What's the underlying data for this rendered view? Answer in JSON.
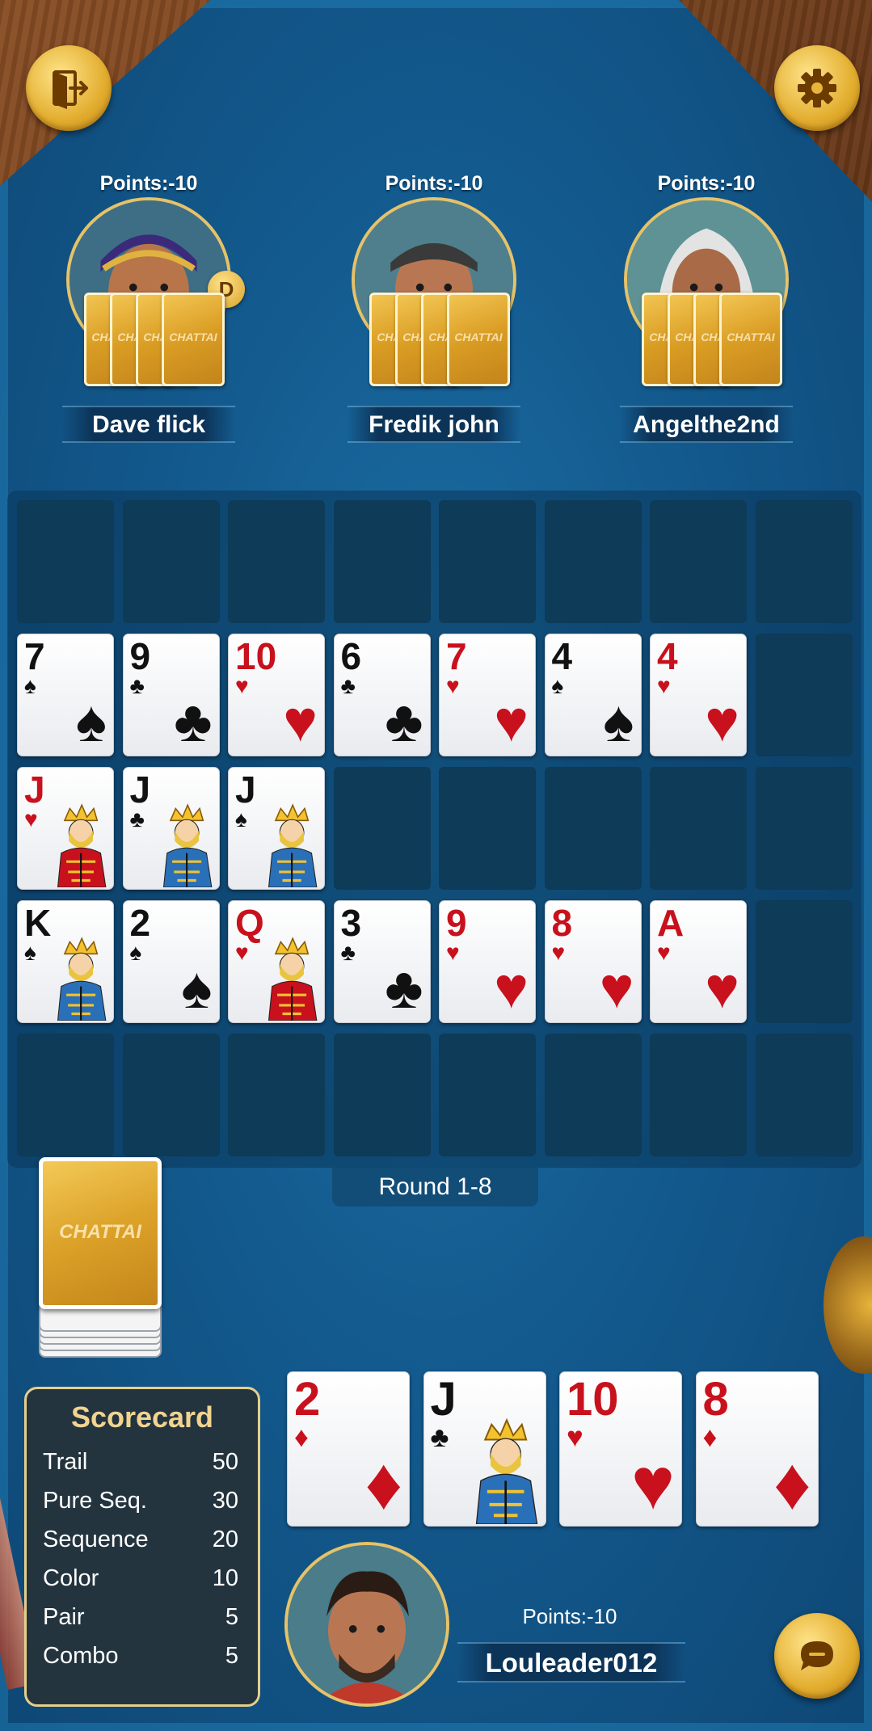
{
  "opponents": [
    {
      "name": "Dave flick",
      "points": "Points:-10",
      "dealer": "D",
      "back_label": "CHATTAI"
    },
    {
      "name": "Fredik john",
      "points": "Points:-10",
      "back_label": "CHATTAI"
    },
    {
      "name": "Angelthe2nd",
      "points": "Points:-10",
      "back_label": "CHATTAI"
    }
  ],
  "buttons": {
    "exit_icon": "exit-door-icon",
    "settings_icon": "gear-icon",
    "chat_icon": "chat-bubble-icon"
  },
  "board": {
    "rows": [
      [],
      [
        {
          "rank": "7",
          "suit": "♠",
          "color": "black"
        },
        {
          "rank": "9",
          "suit": "♣",
          "color": "black"
        },
        {
          "rank": "10",
          "suit": "♥",
          "color": "red"
        },
        {
          "rank": "6",
          "suit": "♣",
          "color": "black"
        },
        {
          "rank": "7",
          "suit": "♥",
          "color": "red"
        },
        {
          "rank": "4",
          "suit": "♠",
          "color": "black"
        },
        {
          "rank": "4",
          "suit": "♥",
          "color": "red"
        }
      ],
      [
        {
          "rank": "J",
          "suit": "♥",
          "color": "red",
          "face": true
        },
        {
          "rank": "J",
          "suit": "♣",
          "color": "black",
          "face": true
        },
        {
          "rank": "J",
          "suit": "♠",
          "color": "black",
          "face": true
        }
      ],
      [
        {
          "rank": "K",
          "suit": "♠",
          "color": "black",
          "face": true
        },
        {
          "rank": "2",
          "suit": "♠",
          "color": "black"
        },
        {
          "rank": "Q",
          "suit": "♥",
          "color": "red",
          "face": true
        },
        {
          "rank": "3",
          "suit": "♣",
          "color": "black"
        },
        {
          "rank": "9",
          "suit": "♥",
          "color": "red"
        },
        {
          "rank": "8",
          "suit": "♥",
          "color": "red"
        },
        {
          "rank": "A",
          "suit": "♥",
          "color": "red"
        }
      ],
      []
    ]
  },
  "round": {
    "label": "Round 1-8"
  },
  "deck": {
    "back_label": "CHATTAI"
  },
  "scorecard": {
    "title": "Scorecard",
    "rows": [
      {
        "label": "Trail",
        "value": "50"
      },
      {
        "label": "Pure Seq.",
        "value": "30"
      },
      {
        "label": "Sequence",
        "value": "20"
      },
      {
        "label": "Color",
        "value": "10"
      },
      {
        "label": "Pair",
        "value": "5"
      },
      {
        "label": "Combo",
        "value": "5"
      }
    ]
  },
  "hand": [
    {
      "rank": "2",
      "suit": "♦",
      "color": "red"
    },
    {
      "rank": "J",
      "suit": "♣",
      "color": "black",
      "face": true
    },
    {
      "rank": "10",
      "suit": "♥",
      "color": "red"
    },
    {
      "rank": "8",
      "suit": "♦",
      "color": "red"
    }
  ],
  "player": {
    "name": "Louleader012",
    "points": "Points:-10"
  },
  "colors": {
    "felt": "#135a8e",
    "gold": "#e2ad2e",
    "card_red": "#c8111d",
    "scorecard_bg": "#24343f",
    "scorecard_title": "#f2d490"
  }
}
